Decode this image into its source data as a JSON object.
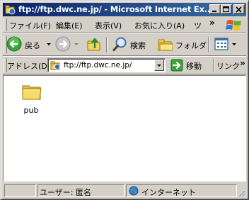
{
  "window": {
    "title": "ftp://ftp.dwc.ne.jp/ - Microsoft Internet Ex..."
  },
  "menu": {
    "file": "ファイル(F)",
    "edit": "編集(E)",
    "view": "表示(V)",
    "favorites": "お気に入り(A)",
    "tools": "ツ",
    "more": "»"
  },
  "toolbar": {
    "back": "戻る",
    "search": "検索",
    "folders": "フォルダ"
  },
  "address": {
    "label": "アドレス(D)",
    "value": "ftp://ftp.dwc.ne.jp/",
    "go": "移動",
    "links": "リンク",
    "links_more": "»"
  },
  "content": {
    "items": [
      {
        "name": "pub",
        "icon": "folder-icon"
      }
    ]
  },
  "status": {
    "user": "ユーザー: 匿名",
    "zone": "インターネット"
  },
  "colors": {
    "titlebar_start": "#0a246a",
    "titlebar_end": "#3a6ea5",
    "face": "#d4d0c8"
  }
}
